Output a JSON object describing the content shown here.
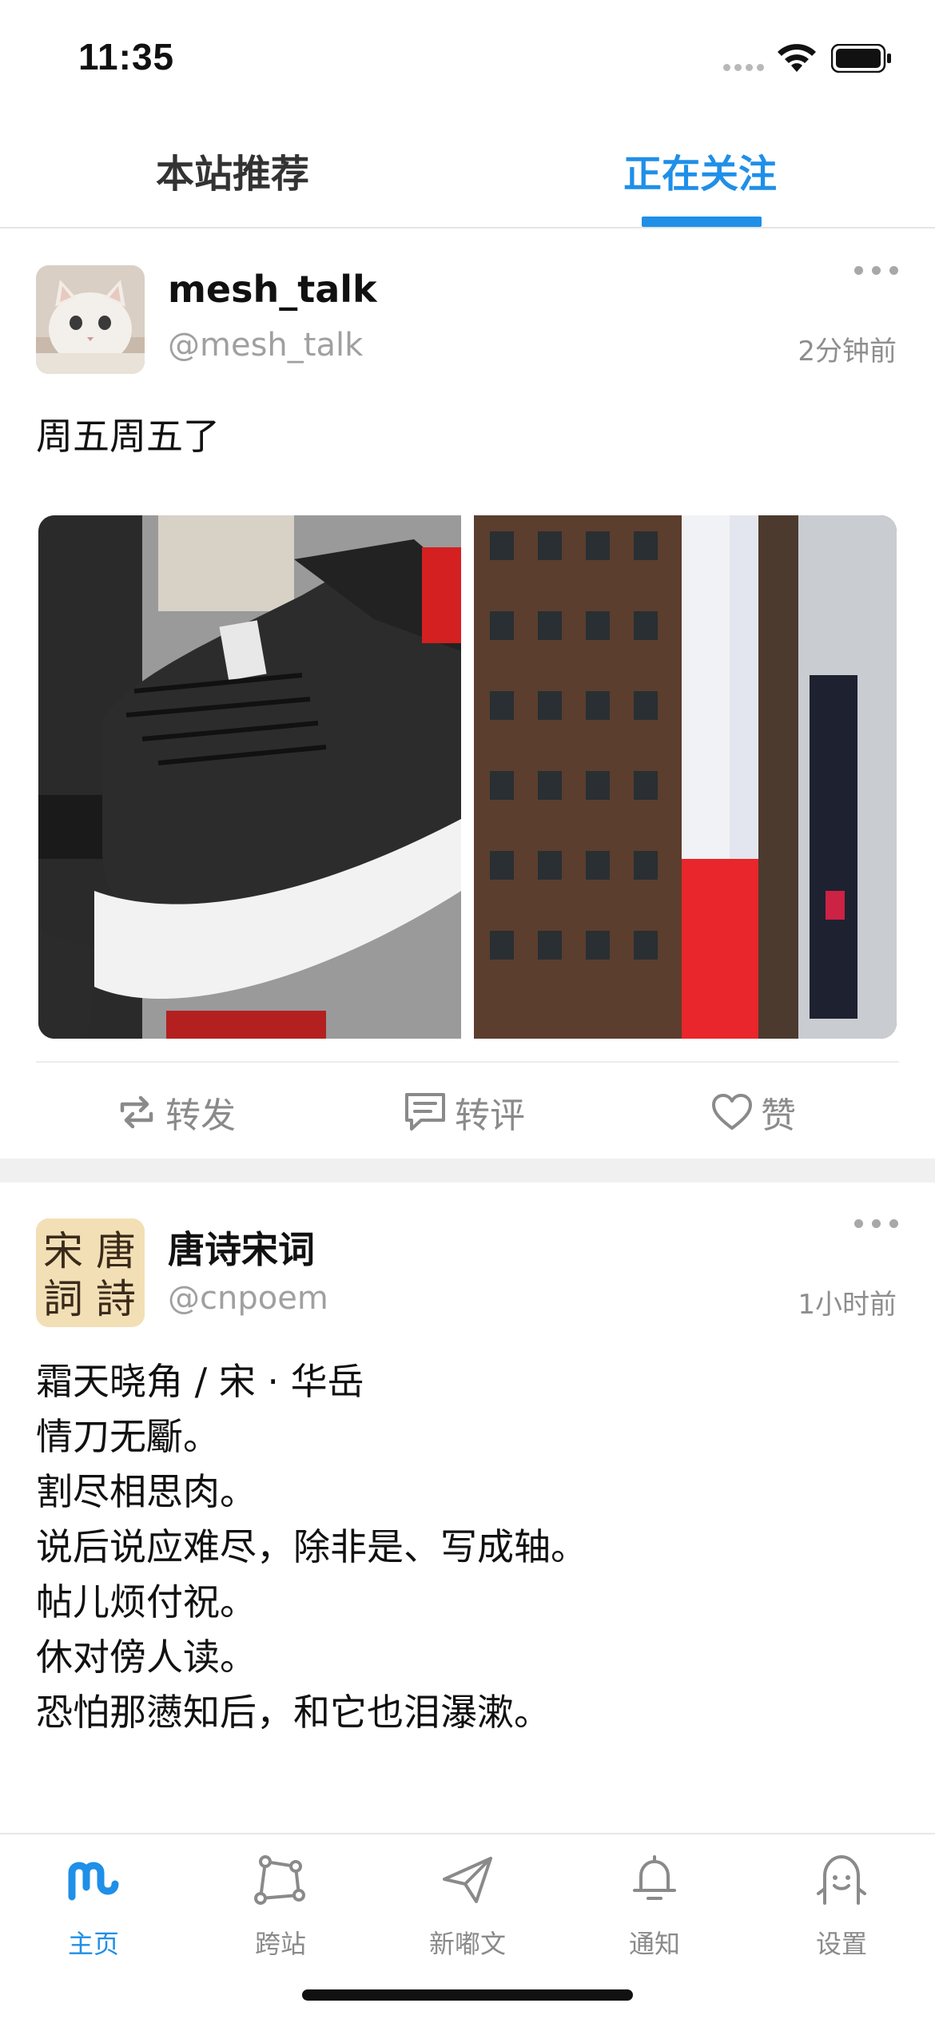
{
  "status_bar": {
    "time": "11:35"
  },
  "tabs": [
    {
      "label": "本站推荐",
      "active": false
    },
    {
      "label": "正在关注",
      "active": true
    }
  ],
  "accent_color": "#1f8fe8",
  "posts": [
    {
      "display_name": "mesh_talk",
      "handle": "@mesh_talk",
      "time": "2分钟前",
      "text": "周五周五了",
      "images": [
        "black high-top sneaker",
        "Times Square building billboard"
      ],
      "actions": {
        "repost": "转发",
        "comment": "转评",
        "like": "赞"
      }
    },
    {
      "display_name": "唐诗宋词",
      "handle": "@cnpoem",
      "time": "1小时前",
      "avatar_chars": [
        "宋",
        "唐",
        "詞",
        "詩"
      ],
      "text": "霜天晓角 / 宋 · 华岳\n情刀无斸。\n割尽相思肉。\n说后说应难尽，除非是、写成轴。\n帖儿烦付祝。\n休对傍人读。\n恐怕那懑知后，和它也泪瀑漱。"
    }
  ],
  "nav": [
    {
      "label": "主页",
      "icon": "mastodon-logo-icon",
      "active": true
    },
    {
      "label": "跨站",
      "icon": "network-icon",
      "active": false
    },
    {
      "label": "新嘟文",
      "icon": "paper-plane-icon",
      "active": false
    },
    {
      "label": "通知",
      "icon": "bell-icon",
      "active": false
    },
    {
      "label": "设置",
      "icon": "profile-face-icon",
      "active": false
    }
  ]
}
